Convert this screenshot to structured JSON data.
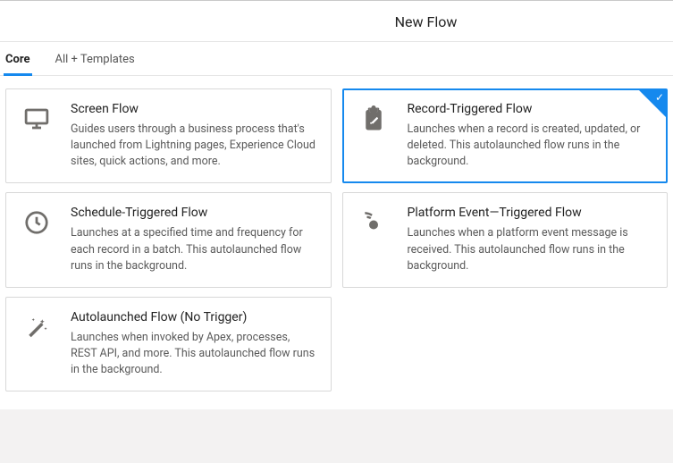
{
  "header": {
    "title": "New Flow"
  },
  "tabs": [
    {
      "label": "Core",
      "active": true
    },
    {
      "label": "All + Templates",
      "active": false
    }
  ],
  "cards": [
    {
      "id": "screen-flow",
      "icon": "monitor-icon",
      "title": "Screen Flow",
      "desc": "Guides users through a business process that's launched from Lightning pages, Experience Cloud sites, quick actions, and more.",
      "selected": false
    },
    {
      "id": "record-triggered-flow",
      "icon": "clipboard-icon",
      "title": "Record-Triggered Flow",
      "desc": "Launches when a record is created, updated, or deleted. This autolaunched flow runs in the background.",
      "selected": true
    },
    {
      "id": "schedule-triggered-flow",
      "icon": "clock-icon",
      "title": "Schedule-Triggered Flow",
      "desc": "Launches at a specified time and frequency for each record in a batch. This autolaunched flow runs in the background.",
      "selected": false
    },
    {
      "id": "platform-event-triggered-flow",
      "icon": "antenna-icon",
      "title": "Platform Event—Triggered Flow",
      "desc": "Launches when a platform event message is received. This autolaunched flow runs in the background.",
      "selected": false
    },
    {
      "id": "autolaunched-flow",
      "icon": "wand-icon",
      "title": "Autolaunched Flow (No Trigger)",
      "desc": "Launches when invoked by Apex, processes, REST API, and more. This autolaunched flow runs in the background.",
      "selected": false
    }
  ]
}
